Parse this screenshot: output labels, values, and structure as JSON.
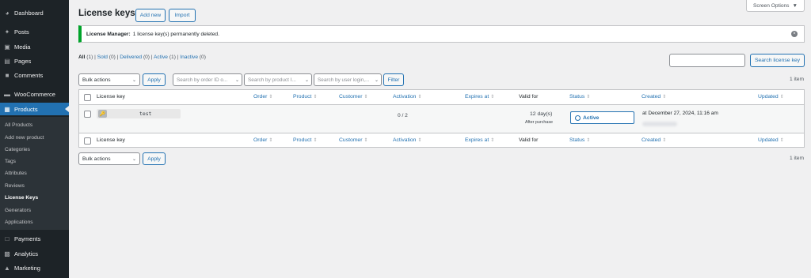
{
  "sidebar": {
    "top_items": [
      {
        "label": "Dashboard",
        "icon": "dashboard-icon"
      },
      {
        "label": "Posts",
        "icon": "pin-icon"
      },
      {
        "label": "Media",
        "icon": "media-icon"
      },
      {
        "label": "Pages",
        "icon": "pages-icon"
      },
      {
        "label": "Comments",
        "icon": "comment-icon"
      },
      {
        "label": "WooCommerce",
        "icon": "woocommerce-icon"
      },
      {
        "label": "Products",
        "icon": "products-icon"
      }
    ],
    "submenu": [
      "All Products",
      "Add new product",
      "Categories",
      "Tags",
      "Attributes",
      "Reviews",
      "License Keys",
      "Generators",
      "Applications"
    ],
    "bottom_items": [
      {
        "label": "Payments",
        "icon": "payments-icon"
      },
      {
        "label": "Analytics",
        "icon": "analytics-icon"
      },
      {
        "label": "Marketing",
        "icon": "megaphone-icon"
      }
    ]
  },
  "header": {
    "title": "License keys",
    "add_new": "Add new",
    "import": "Import",
    "screen_options": "Screen Options"
  },
  "notice": {
    "strong": "License Manager:",
    "text": "1 license key(s) permanently deleted."
  },
  "views": [
    {
      "label": "All",
      "count": "(1)"
    },
    {
      "label": "Sold",
      "count": "(0)"
    },
    {
      "label": "Delivered",
      "count": "(0)"
    },
    {
      "label": "Active",
      "count": "(1)"
    },
    {
      "label": "Inactive",
      "count": "(0)"
    }
  ],
  "search": {
    "button": "Search license key"
  },
  "filters": {
    "bulk_actions": "Bulk actions",
    "apply": "Apply",
    "order_placeholder": "Search by order ID o...",
    "product_placeholder": "Search by product I...",
    "user_placeholder": "Search by user login,...",
    "filter": "Filter",
    "items_count": "1 item"
  },
  "table": {
    "columns": [
      "License key",
      "Order",
      "Product",
      "Customer",
      "Activation",
      "Expires at",
      "Valid for",
      "Status",
      "Created",
      "Updated"
    ],
    "row": {
      "license_key": "test",
      "activation": "0 / 2",
      "valid_for": "12 day(s)",
      "valid_for_note": "After purchase",
      "status": "Active",
      "created": "at December 27, 2024, 11:16 am"
    }
  },
  "colors": {
    "accent": "#2271b1",
    "sidebar": "#1d2327",
    "success": "#00a32a"
  }
}
